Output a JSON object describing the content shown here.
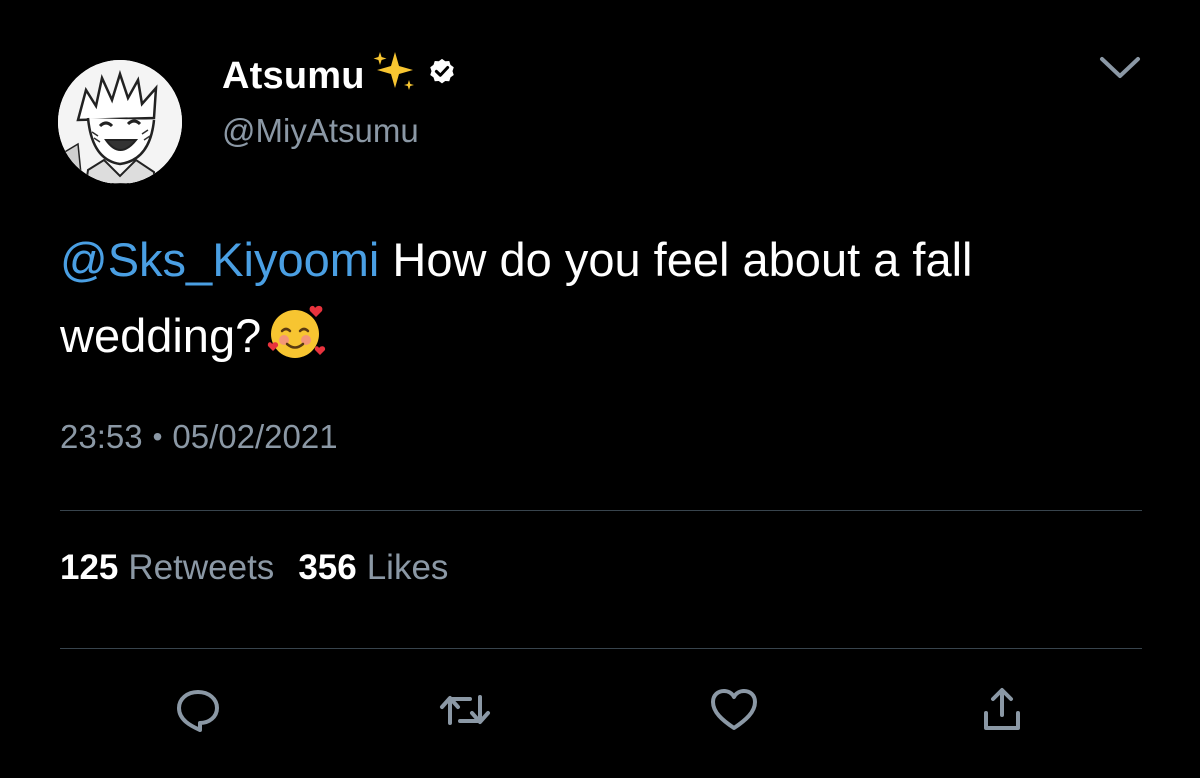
{
  "author": {
    "display_name": "Atsumu",
    "name_emoji": "sparkles-icon",
    "verified_badge": "verified-icon",
    "handle": "@MiyAtsumu",
    "avatar": "avatar"
  },
  "tweet": {
    "mention": "@Sks_Kiyoomi",
    "text": " How do you feel about a fall wedding?",
    "trailing_emoji": "smiling-face-with-hearts-icon"
  },
  "timestamp": {
    "time": "23:53",
    "separator": "•",
    "date": "05/02/2021"
  },
  "stats": {
    "retweets_count": "125",
    "retweets_label": "Retweets",
    "likes_count": "356",
    "likes_label": "Likes"
  },
  "actions": [
    "reply-icon",
    "retweet-icon",
    "like-icon",
    "share-icon"
  ],
  "colors": {
    "background": "#000000",
    "text": "#ffffff",
    "secondary": "#8b98a5",
    "mention": "#4a9fe3",
    "divider": "#38444d"
  }
}
